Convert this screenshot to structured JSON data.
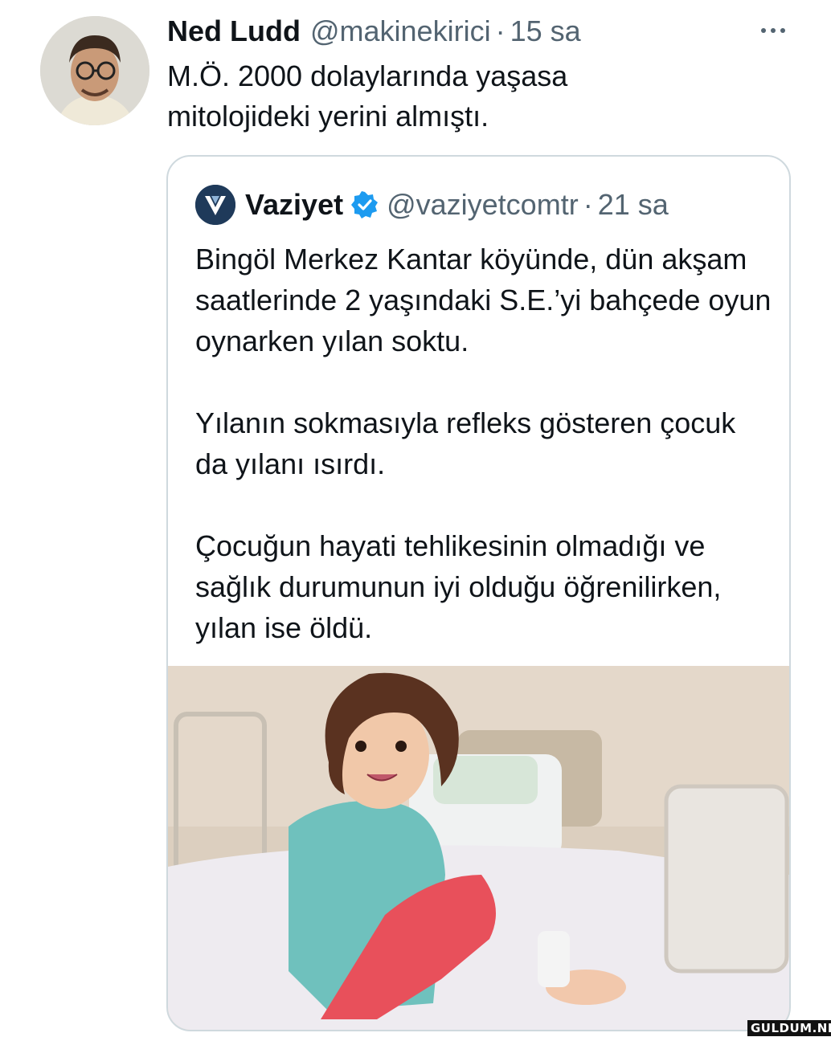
{
  "tweet": {
    "author_name": "Ned Ludd",
    "author_handle": "@makinekirici",
    "separator": "·",
    "time": "15 sa",
    "text": "M.Ö. 2000 dolaylarında yaşasa\nmitolojideki yerini almıştı.",
    "more_icon": "more-horizontal-icon",
    "avatar": "avatar-photo"
  },
  "quoted_tweet": {
    "author_name": "Vaziyet",
    "author_handle": "@vaziyetcomtr",
    "separator": "·",
    "time": "21 sa",
    "verified_icon": "verified-badge-icon",
    "logo_icon": "vaziyet-logo-icon",
    "paragraphs": [
      "Bingöl Merkez Kantar köyünde, dün akşam saatlerinde 2 yaşındaki S.E.’yi bahçede oyun oynarken yılan soktu.",
      "Yılanın sokmasıyla refleks gösteren çocuk da yılanı ısırdı.",
      "Çocuğun hayati tehlikesinin olmadığı ve sağlık durumunun iyi olduğu öğrenilirken, yılan ise öldü."
    ],
    "media": "photo-child-in-hospital-bed"
  },
  "watermark": {
    "text": "GULDUM.NET"
  },
  "colors": {
    "text": "#0f1419",
    "secondary": "#536471",
    "border": "#cfd9de",
    "verified": "#1d9bf0",
    "vaziyet_logo": "#1f3a5a"
  }
}
